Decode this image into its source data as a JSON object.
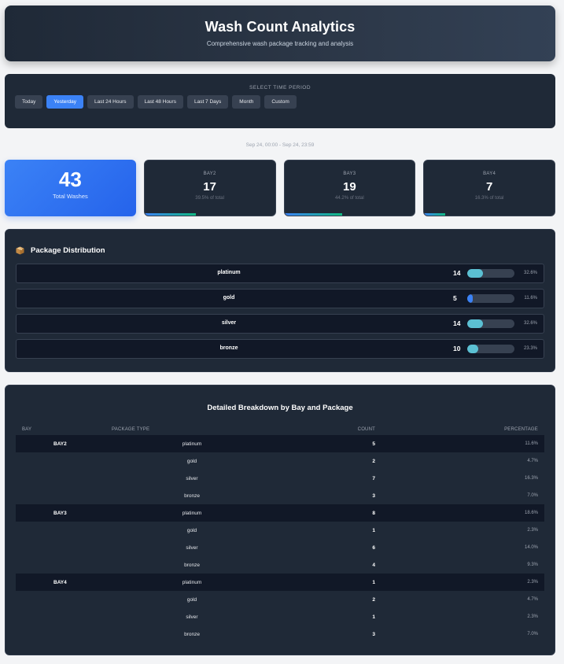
{
  "header": {
    "title": "Wash Count Analytics",
    "subtitle": "Comprehensive wash package tracking and analysis"
  },
  "period": {
    "title": "SELECT TIME PERIOD",
    "buttons": [
      {
        "label": "Today",
        "active": false
      },
      {
        "label": "Yesterday",
        "active": true
      },
      {
        "label": "Last 24 Hours",
        "active": false
      },
      {
        "label": "Last 48 Hours",
        "active": false
      },
      {
        "label": "Last 7 Days",
        "active": false
      },
      {
        "label": "Month",
        "active": false
      },
      {
        "label": "Custom",
        "active": false
      }
    ],
    "range_text": "Sep 24, 00:00 - Sep 24, 23:59"
  },
  "summary": {
    "total": "43",
    "total_label": "Total Washes",
    "bays": [
      {
        "name": "BAY2",
        "count": "17",
        "pct_text": "39.5% of total",
        "pct": 39.5
      },
      {
        "name": "BAY3",
        "count": "19",
        "pct_text": "44.2% of total",
        "pct": 44.2
      },
      {
        "name": "BAY4",
        "count": "7",
        "pct_text": "16.3% of total",
        "pct": 16.3
      }
    ]
  },
  "distribution": {
    "title": "Package Distribution",
    "icon": "package-box-icon",
    "rows": [
      {
        "name": "platinum",
        "count": "14",
        "pct_text": "32.6%",
        "pct": 32.6
      },
      {
        "name": "gold",
        "count": "5",
        "pct_text": "11.6%",
        "pct": 11.6
      },
      {
        "name": "silver",
        "count": "14",
        "pct_text": "32.6%",
        "pct": 32.6
      },
      {
        "name": "bronze",
        "count": "10",
        "pct_text": "23.3%",
        "pct": 23.3
      }
    ]
  },
  "breakdown": {
    "title": "Detailed Breakdown by Bay and Package",
    "headers": {
      "bay": "BAY",
      "type": "PACKAGE TYPE",
      "count": "COUNT",
      "pct": "PERCENTAGE"
    },
    "rows": [
      {
        "bay": "BAY2",
        "type": "platinum",
        "count": "5",
        "pct": "11.6%"
      },
      {
        "bay": "",
        "type": "gold",
        "count": "2",
        "pct": "4.7%"
      },
      {
        "bay": "",
        "type": "silver",
        "count": "7",
        "pct": "16.3%"
      },
      {
        "bay": "",
        "type": "bronze",
        "count": "3",
        "pct": "7.0%"
      },
      {
        "bay": "BAY3",
        "type": "platinum",
        "count": "8",
        "pct": "18.6%"
      },
      {
        "bay": "",
        "type": "gold",
        "count": "1",
        "pct": "2.3%"
      },
      {
        "bay": "",
        "type": "silver",
        "count": "6",
        "pct": "14.0%"
      },
      {
        "bay": "",
        "type": "bronze",
        "count": "4",
        "pct": "9.3%"
      },
      {
        "bay": "BAY4",
        "type": "platinum",
        "count": "1",
        "pct": "2.3%"
      },
      {
        "bay": "",
        "type": "gold",
        "count": "2",
        "pct": "4.7%"
      },
      {
        "bay": "",
        "type": "silver",
        "count": "1",
        "pct": "2.3%"
      },
      {
        "bay": "",
        "type": "bronze",
        "count": "3",
        "pct": "7.0%"
      }
    ]
  },
  "colors": {
    "accent": "#3b82f6",
    "panel": "#1f2937",
    "bar_fill": "#5bc0d3",
    "bar_fill_low": "#3b82f6"
  }
}
